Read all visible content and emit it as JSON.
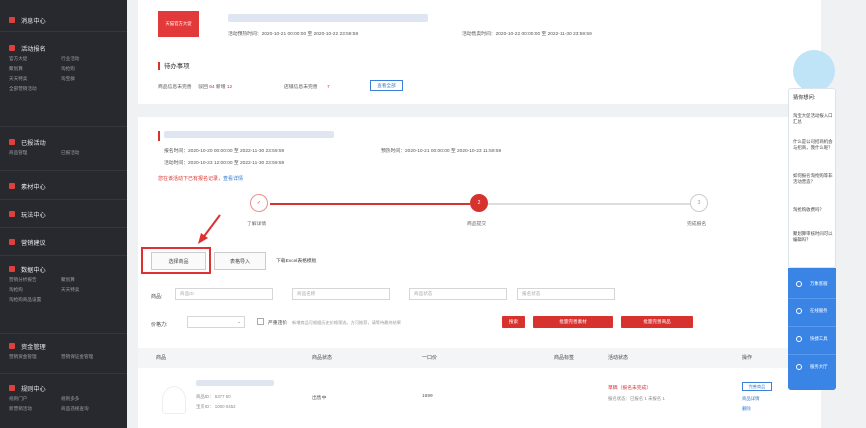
{
  "sidebar": {
    "top_cut": "……",
    "groups": [
      {
        "title": "消息中心",
        "items": []
      },
      {
        "title": "活动报名",
        "items": [
          "官方大促",
          "行业活动",
          "聚划算",
          "淘抢购",
          "天天特卖",
          "淘宝群",
          "全部营销活动"
        ]
      },
      {
        "title": "已报活动",
        "items": [
          "商品管理",
          "已报活动"
        ]
      },
      {
        "title": "素材中心",
        "items": []
      },
      {
        "title": "玩法中心",
        "items": []
      },
      {
        "title": "营销建议",
        "items": []
      },
      {
        "title": "数据中心",
        "items": [
          "营销分析报告",
          "聚划算",
          "淘抢购",
          "天天特卖",
          "淘抢购商品设置"
        ]
      },
      {
        "title": "资金管理",
        "items": [
          "营销资金管理",
          "营销保证金管理"
        ]
      },
      {
        "title": "规则中心",
        "items": [
          "规则门户",
          "规则多多",
          "新营销活动",
          "商品违规查询"
        ]
      }
    ]
  },
  "card1": {
    "banner_label": "天猫官方大促",
    "signup_time": "活动预热时间：2020-10-21 00:00:00 至 2020-10-22 23:59:59",
    "event_time": "活动售卖时间：2020-10-22 00:00:00 至 2022-11-30 23:59:59",
    "todo_title": "待办事项",
    "todo_label": "商品信息未完善",
    "todo_reject": "驳回",
    "todo_reject_count": "64",
    "todo_new": "新增",
    "todo_new_count": "12",
    "todo_store": "店铺信息未完善",
    "todo_store_count": "7",
    "view_all": "查看全部"
  },
  "card2": {
    "reg_time": "报名时间：2020-10-20 00:00:00 至 2022-11-30 23:59:59",
    "warm_time": "预热时间：2020-10-21 00:00:00 至 2020-10-23 11:59:59",
    "act_time": "活动时间：2020-10-23 12:00:00 至 2022-11-30 23:59:59",
    "notice": "您在该活动下已有报名记录，",
    "notice_link": "查看详情",
    "steps": [
      {
        "label": "了解详情",
        "mark": "✓"
      },
      {
        "label": "商品提交",
        "mark": "2"
      },
      {
        "label": "完成报名",
        "mark": "3"
      }
    ],
    "select_goods": "选择商品",
    "batch_import": "表格导入",
    "download_tpl": "下载Excel表格模板",
    "filter_goods_label": "商品:",
    "filter_goods_id": "商品ID",
    "filter_goods_name": "商品名称",
    "filter_status": "商品状态",
    "filter_sign_status": "报名状态",
    "filter_price_label": "价格力:",
    "strict_check": "严重违价",
    "strict_desc": "新增商品可根据历史价格筛选，方可推荐，请等待最终结果",
    "search_btn": "搜索",
    "batch_modify": "批量完善素材",
    "batch_submit": "批量完善商品",
    "table_headers": [
      "商品",
      "商品状态",
      "一口价",
      "商品标签",
      "活动状态",
      "操作"
    ],
    "row": {
      "goods_id": "商品ID：  6377          50",
      "sku_id": "宝贝ID：  1000          0452",
      "status": "出售中",
      "price": "1699",
      "act_status": "草稿（报名未完成）",
      "act_sub": "报名状态：已报名 1  未报名 1",
      "op1": "完善商品",
      "op2": "商品详情",
      "op3": "删除"
    }
  },
  "assistant": {
    "title": "猜你想问:",
    "questions": [
      "淘宝大促活动报入口汇总",
      "什么是公司招商机会与招商，我什么呢？",
      "如何报名淘抢购等非活动营造？",
      "淘抢购收费吗？",
      "聚划算审核时间可以编辑吗？"
    ],
    "tools": [
      "万象客服",
      "在线服务",
      "快捷工具",
      "服务大厅"
    ]
  },
  "colors": {
    "accent": "#d8322e",
    "link": "#3377cc",
    "sidebar_bg": "#27292e",
    "assistant_blue": "#3a84e6"
  }
}
